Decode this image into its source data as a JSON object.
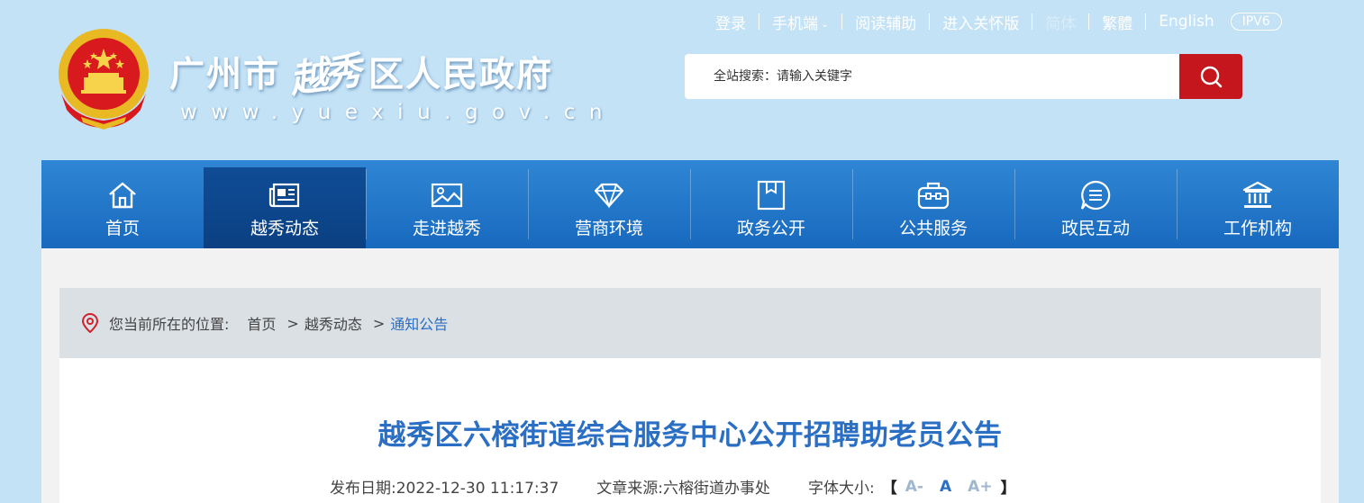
{
  "header": {
    "site_name_prefix": "广州市",
    "site_name_brush": "越秀",
    "site_name_suffix": "区人民政府",
    "site_url": "www.yuexiu.gov.cn"
  },
  "toplinks": {
    "login": "登录",
    "mobile": "手机端",
    "reading_aid": "阅读辅助",
    "elder_mode": "进入关怀版",
    "simplified": "简体",
    "traditional": "繁體",
    "english": "English",
    "ipv6": "IPV6"
  },
  "search": {
    "placeholder": "全站搜索：请输入关键字"
  },
  "nav": {
    "items": [
      {
        "label": "首页",
        "icon": "home-icon"
      },
      {
        "label": "越秀动态",
        "icon": "newspaper-icon"
      },
      {
        "label": "走进越秀",
        "icon": "picture-icon"
      },
      {
        "label": "营商环境",
        "icon": "diamond-icon"
      },
      {
        "label": "政务公开",
        "icon": "folder-icon"
      },
      {
        "label": "公共服务",
        "icon": "briefcase-icon"
      },
      {
        "label": "政民互动",
        "icon": "chat-icon"
      },
      {
        "label": "工作机构",
        "icon": "institution-icon"
      }
    ],
    "active_index": 1
  },
  "breadcrumb": {
    "label": "您当前所在的位置:",
    "items": [
      "首页",
      "越秀动态",
      "通知公告"
    ],
    "separator": ">"
  },
  "article": {
    "title": "越秀区六榕街道综合服务中心公开招聘助老员公告",
    "date_label": "发布日期:",
    "date": "2022-12-30 11:17:37",
    "source_label": "文章来源:",
    "source": "六榕街道办事处",
    "font_label": "字体大小:",
    "bracket_open": "【",
    "font_small": "A-",
    "font_medium": "A",
    "font_large": "A+",
    "bracket_close": "】"
  },
  "colors": {
    "page_bg": "#c3e2f6",
    "nav_blue": "#1f74c6",
    "nav_active": "#0c4589",
    "search_button": "#c4161c",
    "title_blue": "#2a6fc4"
  }
}
